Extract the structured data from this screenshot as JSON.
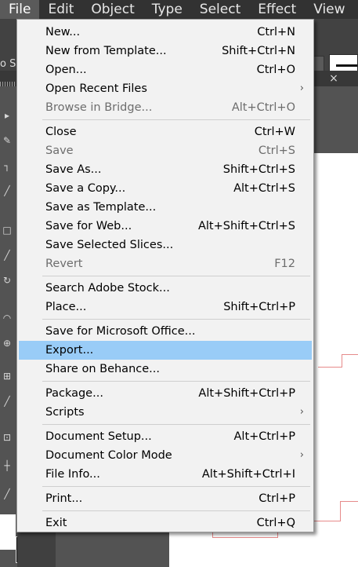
{
  "menubar": {
    "items": [
      {
        "label": "File",
        "active": true
      },
      {
        "label": "Edit",
        "active": false
      },
      {
        "label": "Object",
        "active": false
      },
      {
        "label": "Type",
        "active": false
      },
      {
        "label": "Select",
        "active": false
      },
      {
        "label": "Effect",
        "active": false
      },
      {
        "label": "View",
        "active": false
      }
    ]
  },
  "controlbar": {
    "left_text": "o Se",
    "stroke_preview": "stroke-weight-preview"
  },
  "document_tab": {
    "close_symbol": "×"
  },
  "file_menu": {
    "groups": [
      [
        {
          "label": "New...",
          "shortcut": "Ctrl+N",
          "disabled": false
        },
        {
          "label": "New from Template...",
          "shortcut": "Shift+Ctrl+N",
          "disabled": false
        },
        {
          "label": "Open...",
          "shortcut": "Ctrl+O",
          "disabled": false
        },
        {
          "label": "Open Recent Files",
          "shortcut": "",
          "submenu": true,
          "disabled": false
        },
        {
          "label": "Browse in Bridge...",
          "shortcut": "Alt+Ctrl+O",
          "disabled": true
        }
      ],
      [
        {
          "label": "Close",
          "shortcut": "Ctrl+W",
          "disabled": false
        },
        {
          "label": "Save",
          "shortcut": "Ctrl+S",
          "disabled": true
        },
        {
          "label": "Save As...",
          "shortcut": "Shift+Ctrl+S",
          "disabled": false
        },
        {
          "label": "Save a Copy...",
          "shortcut": "Alt+Ctrl+S",
          "disabled": false
        },
        {
          "label": "Save as Template...",
          "shortcut": "",
          "disabled": false
        },
        {
          "label": "Save for Web...",
          "shortcut": "Alt+Shift+Ctrl+S",
          "disabled": false
        },
        {
          "label": "Save Selected Slices...",
          "shortcut": "",
          "disabled": false
        },
        {
          "label": "Revert",
          "shortcut": "F12",
          "disabled": true
        }
      ],
      [
        {
          "label": "Search Adobe Stock...",
          "shortcut": "",
          "disabled": false
        },
        {
          "label": "Place...",
          "shortcut": "Shift+Ctrl+P",
          "disabled": false
        }
      ],
      [
        {
          "label": "Save for Microsoft Office...",
          "shortcut": "",
          "disabled": false
        },
        {
          "label": "Export...",
          "shortcut": "",
          "disabled": false,
          "highlighted": true
        },
        {
          "label": "Share on Behance...",
          "shortcut": "",
          "disabled": false
        }
      ],
      [
        {
          "label": "Package...",
          "shortcut": "Alt+Shift+Ctrl+P",
          "disabled": false
        },
        {
          "label": "Scripts",
          "shortcut": "",
          "submenu": true,
          "disabled": false
        }
      ],
      [
        {
          "label": "Document Setup...",
          "shortcut": "Alt+Ctrl+P",
          "disabled": false
        },
        {
          "label": "Document Color Mode",
          "shortcut": "",
          "submenu": true,
          "disabled": false
        },
        {
          "label": "File Info...",
          "shortcut": "Alt+Shift+Ctrl+I",
          "disabled": false
        }
      ],
      [
        {
          "label": "Print...",
          "shortcut": "Ctrl+P",
          "disabled": false
        }
      ],
      [
        {
          "label": "Exit",
          "shortcut": "Ctrl+Q",
          "disabled": false
        }
      ]
    ],
    "submenu_arrow": "›"
  },
  "colors": {
    "menu_background": "#f2f2f2",
    "menu_highlight": "#99ccf7",
    "menubar_background": "#323232",
    "app_background": "#535353"
  }
}
